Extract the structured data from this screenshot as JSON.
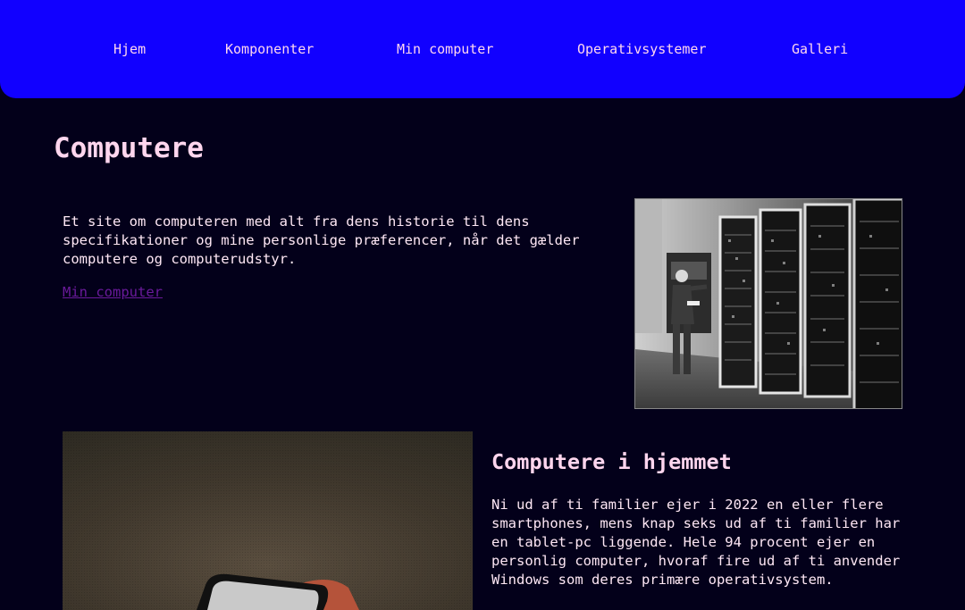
{
  "nav": {
    "items": [
      {
        "label": "Hjem"
      },
      {
        "label": "Komponenter"
      },
      {
        "label": "Min computer"
      },
      {
        "label": "Operativsystemer"
      },
      {
        "label": "Galleri"
      }
    ]
  },
  "colors": {
    "nav_background": "#1100ff",
    "page_background": "#03001a",
    "heading": "#ffd6ee",
    "link": "#6a1a9a"
  },
  "hero": {
    "title": "Computere",
    "intro": "Et site om computeren med alt fra dens historie til dens specifikationer og mine personlige præferencer, når det gælder computere og computerudstyr.",
    "link_label": "Min computer",
    "image_icon": "mainframe-photo-icon"
  },
  "home_section": {
    "title": "Computere i hjemmet",
    "text": "Ni ud af ti familier ejer i 2022 en eller flere smartphones, mens knap seks ud af ti familier har en tablet-pc liggende. Hele 94 procent ejer en personlig computer, hvoraf fire ud af ti anvender Windows som deres primære operativsystem.",
    "image_icon": "laptop-photo-icon"
  }
}
